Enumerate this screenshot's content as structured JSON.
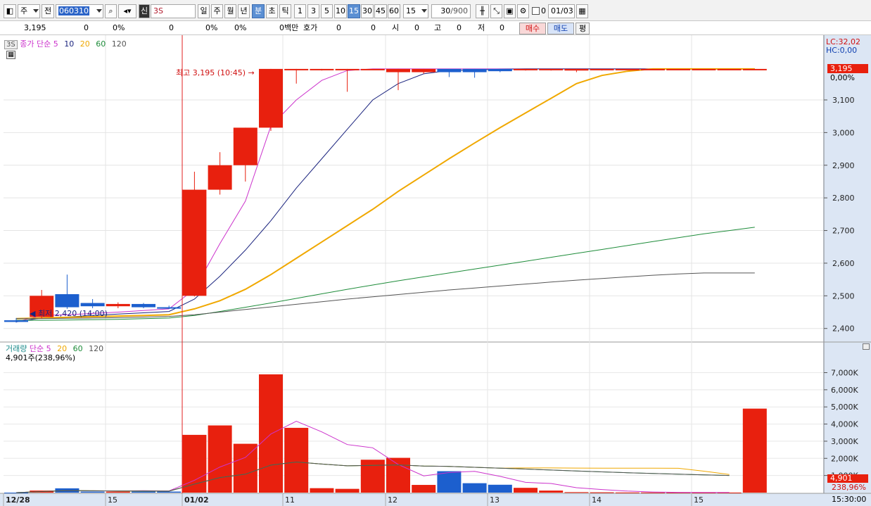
{
  "toolbar": {
    "type_select": "주",
    "market_label": "전",
    "code_value": "060310",
    "symbol_prefix": "신",
    "symbol_name": "3S",
    "period_day": "일",
    "period_week": "주",
    "period_month": "월",
    "period_year": "년",
    "period_minute": "분",
    "period_second": "초",
    "period_tick": "틱",
    "intervals": [
      "1",
      "3",
      "5",
      "10",
      "15",
      "30",
      "45",
      "60"
    ],
    "interval_value": "15",
    "count_value": "30",
    "count_max": "/900",
    "check_label": "0",
    "date_value": "01/03"
  },
  "quote": {
    "price": "3,195",
    "change": "0",
    "change_rate": "0%",
    "volume": "0",
    "vol_rate": "0%",
    "rate3": "0%",
    "amount_label": "0백만",
    "quote_label": "호가",
    "quote_value": "0",
    "val2": "0",
    "open_label": "시",
    "open_value": "0",
    "high_label": "고",
    "high_value": "0",
    "low_label": "저",
    "low_value": "0",
    "buy_button": "매수",
    "sell_button": "매도",
    "eval_button": "평"
  },
  "price_panel": {
    "tag": "3S",
    "legend_title": "종가 단순",
    "periods": [
      "5",
      "10",
      "20",
      "60",
      "120"
    ],
    "lc": "LC:32,02",
    "hc": "HC:0,00",
    "current_price_tag": "3,195",
    "current_rate_tag": "0,00%",
    "high_annotation": "최고 3,195 (10:45)",
    "low_annotation": "최저 2,420 (14:00)",
    "yticks": [
      "3,100",
      "3,000",
      "2,900",
      "2,800",
      "2,700",
      "2,600",
      "2,500",
      "2,400"
    ]
  },
  "volume_panel": {
    "legend_title": "거래량",
    "legend_ma": "단순",
    "periods": [
      "5",
      "20",
      "60",
      "120"
    ],
    "last_volume": "4,901주(238,96%)",
    "yticks": [
      "7,000K",
      "6,000K",
      "5,000K",
      "4,000K",
      "3,000K",
      "2,000K",
      "1,000K"
    ],
    "current_volume_tag": "4,901",
    "current_rate_tag": "238,96%"
  },
  "xaxis": {
    "labels": [
      "12/28",
      "15",
      "01/02",
      "11",
      "12",
      "13",
      "14",
      "15"
    ],
    "time_label": "15:30:00"
  },
  "colors": {
    "up": "#e8200e",
    "down": "#1c5fce",
    "ma5": "#cc33cc",
    "ma10": "#1a237e",
    "ma20": "#f0a800",
    "ma60": "#1e8c3a",
    "ma120": "#555555",
    "current_tag": "#e8200e",
    "axis_background": "#dce6f4"
  },
  "chart_data": {
    "type": "candlestick",
    "categories": [
      "12/28",
      "12/28",
      "12/28",
      "12/28",
      "12/28",
      "12/28",
      "12/28",
      "01/02",
      "01/02",
      "01/02",
      "01/02",
      "01/02",
      "01/02",
      "01/02",
      "01/02",
      "01/02",
      "01/02",
      "01/02",
      "01/02",
      "01/02",
      "01/02",
      "01/02",
      "01/02",
      "01/02",
      "01/02",
      "01/02",
      "01/02",
      "01/02",
      "01/02",
      "01/02"
    ],
    "ohlc": [
      [
        2425,
        2432,
        2418,
        2420
      ],
      [
        2435,
        2518,
        2430,
        2500
      ],
      [
        2505,
        2565,
        2460,
        2465
      ],
      [
        2478,
        2490,
        2462,
        2468
      ],
      [
        2468,
        2480,
        2462,
        2475
      ],
      [
        2475,
        2478,
        2462,
        2465
      ],
      [
        2465,
        2470,
        2460,
        2462
      ],
      [
        2500,
        2880,
        2498,
        2825
      ],
      [
        2825,
        2940,
        2810,
        2900
      ],
      [
        2900,
        3015,
        2850,
        3015
      ],
      [
        3015,
        3195,
        3005,
        3195
      ],
      [
        3195,
        3195,
        3150,
        3195
      ],
      [
        3195,
        3195,
        3190,
        3195
      ],
      [
        3195,
        3195,
        3125,
        3195
      ],
      [
        3195,
        3195,
        3195,
        3195
      ],
      [
        3185,
        3195,
        3130,
        3195
      ],
      [
        3185,
        3195,
        3180,
        3195
      ],
      [
        3195,
        3195,
        3170,
        3185
      ],
      [
        3195,
        3195,
        3168,
        3185
      ],
      [
        3195,
        3195,
        3185,
        3188
      ],
      [
        3195,
        3195,
        3190,
        3195
      ],
      [
        3195,
        3195,
        3190,
        3195
      ],
      [
        3190,
        3195,
        3185,
        3195
      ],
      [
        3195,
        3195,
        3190,
        3195
      ],
      [
        3195,
        3195,
        3195,
        3195
      ],
      [
        3195,
        3195,
        3195,
        3195
      ],
      [
        3195,
        3195,
        3195,
        3195
      ],
      [
        3195,
        3195,
        3195,
        3195
      ],
      [
        3195,
        3195,
        3195,
        3195
      ],
      [
        3195,
        3195,
        3195,
        3195
      ]
    ],
    "volume": [
      0,
      120,
      250,
      60,
      60,
      60,
      60,
      3370,
      3920,
      2850,
      6900,
      3780,
      260,
      220,
      1920,
      2030,
      450,
      1250,
      550,
      460,
      280,
      120,
      30,
      20,
      10,
      10,
      10,
      5,
      5,
      4901
    ],
    "ma": [
      {
        "name": "5",
        "values": [
          2420,
          2440,
          2442,
          2446,
          2450,
          2455,
          2460,
          2520,
          2660,
          2790,
          3020,
          3100,
          3160,
          3190,
          3195,
          3195,
          3195,
          3195,
          3195,
          3195,
          3195,
          3195,
          3195,
          3195,
          3195,
          3195,
          3195,
          3195,
          3195,
          3195
        ]
      },
      {
        "name": "10",
        "values": [
          2420,
          2432,
          2435,
          2440,
          2444,
          2448,
          2452,
          2490,
          2560,
          2640,
          2730,
          2830,
          2920,
          3010,
          3100,
          3150,
          3180,
          3190,
          3192,
          3194,
          3195,
          3195,
          3195,
          3195,
          3195,
          3195,
          3195,
          3195,
          3195,
          3195
        ]
      },
      {
        "name": "20",
        "values": [
          2430,
          2432,
          2434,
          2436,
          2438,
          2440,
          2442,
          2460,
          2485,
          2520,
          2565,
          2615,
          2665,
          2715,
          2765,
          2820,
          2870,
          2920,
          2968,
          3015,
          3060,
          3105,
          3150,
          3175,
          3188,
          3195,
          3195,
          3195,
          3195,
          3195
        ]
      },
      {
        "name": "60",
        "values": [
          2425,
          2425,
          2426,
          2427,
          2428,
          2430,
          2432,
          2440,
          2452,
          2465,
          2478,
          2492,
          2506,
          2520,
          2533,
          2546,
          2558,
          2570,
          2582,
          2594,
          2606,
          2618,
          2630,
          2642,
          2654,
          2666,
          2678,
          2690,
          2700,
          2710
        ]
      },
      {
        "name": "120",
        "values": [
          2430,
          2430,
          2431,
          2432,
          2433,
          2435,
          2437,
          2442,
          2450,
          2458,
          2466,
          2474,
          2482,
          2490,
          2497,
          2504,
          2511,
          2518,
          2524,
          2530,
          2536,
          2542,
          2548,
          2553,
          2558,
          2563,
          2567,
          2570,
          2570,
          2570
        ]
      }
    ],
    "ylim": [
      2380,
      3225
    ],
    "volume_ylim": [
      0,
      7800
    ],
    "grid": true
  }
}
